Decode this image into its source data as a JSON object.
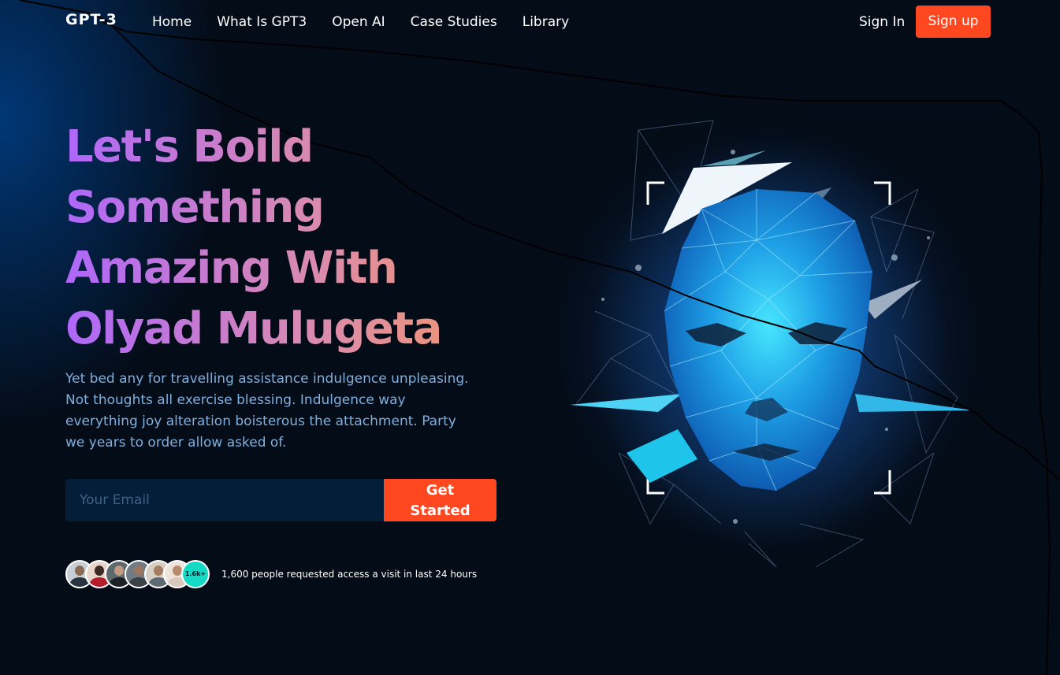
{
  "colors": {
    "background": "#040c18",
    "accent": "#ff4820",
    "heading_gradient_start": "#ae67fa",
    "heading_gradient_end": "#f49867",
    "subtitle_text": "#81afdd",
    "input_background": "#052d56",
    "badge": "#14d9c4"
  },
  "nav": {
    "logo": "GPT-3",
    "links": [
      "Home",
      "What Is GPT3",
      "Open AI",
      "Case Studies",
      "Library"
    ],
    "sign_in": "Sign In",
    "sign_up": "Sign up"
  },
  "hero": {
    "headline_lines": [
      "Let's Boild",
      "Something",
      "Amazing With",
      "Olyad Mulugeta"
    ],
    "subtitle_lines": [
      "Yet bed any for travelling assistance indulgence unpleasing.",
      "Not thoughts all exercise blessing. Indulgence way",
      "everything joy alteration boisterous the attachment. Party",
      "we years to order allow asked of."
    ],
    "email_placeholder": "Your Email",
    "cta_lines": [
      "Get",
      "Started"
    ],
    "avatars": [
      "person-1",
      "person-2",
      "person-3",
      "person-4",
      "person-5",
      "person-6"
    ],
    "people_count_badge": "1.6k+",
    "people_text": "1,600 people requested access a visit in last 24 hours"
  },
  "illustration": {
    "icon": "ai-polygon-face-icon"
  }
}
